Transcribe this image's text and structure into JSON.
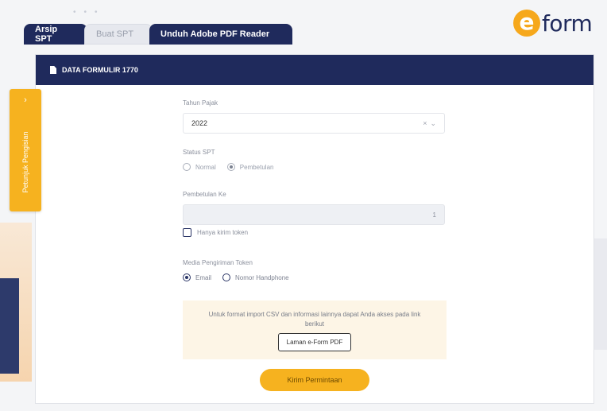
{
  "tabs": [
    {
      "label": "Arsip SPT",
      "state": "dark"
    },
    {
      "label": "Buat SPT",
      "state": "active"
    },
    {
      "label": "Unduh Adobe PDF Reader",
      "state": "dark"
    }
  ],
  "logo": {
    "letter": "e",
    "text": "form"
  },
  "panel": {
    "title": "DATA FORMULIR 1770"
  },
  "side_tab": {
    "label": "Petunjuk Pengisian",
    "chevron": "›"
  },
  "form": {
    "tahun_pajak": {
      "label": "Tahun Pajak",
      "value": "2022",
      "clear": "×",
      "caret": "⌄"
    },
    "status_spt": {
      "label": "Status SPT",
      "options": [
        {
          "label": "Normal",
          "checked": false
        },
        {
          "label": "Pembetulan",
          "checked": true
        }
      ]
    },
    "pembetulan_ke": {
      "label": "Pembetulan Ke",
      "value": "1"
    },
    "hanya_kirim_token": {
      "label": "Hanya kirim token",
      "checked": false
    },
    "media_pengiriman": {
      "label": "Media Pengiriman Token",
      "options": [
        {
          "label": "Email",
          "checked": true
        },
        {
          "label": "Nomor Handphone",
          "checked": false
        }
      ]
    },
    "info": {
      "text": "Untuk format import CSV dan informasi lainnya dapat Anda akses pada link berikut",
      "link_label": "Laman e-Form PDF"
    },
    "submit_label": "Kirim Permintaan"
  },
  "colors": {
    "navy": "#1f2a5c",
    "accent": "#f6b21f",
    "info_bg": "#fdf5e6"
  }
}
